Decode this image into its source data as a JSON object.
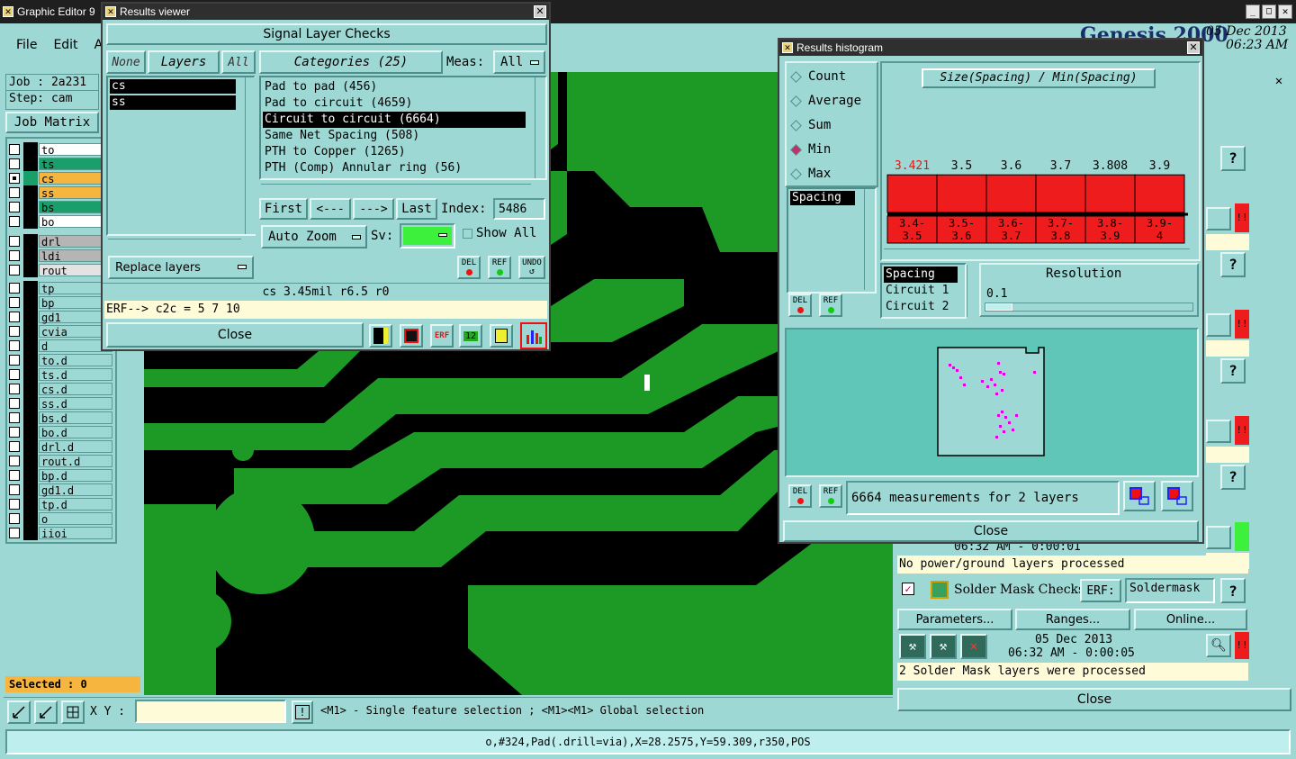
{
  "main": {
    "title": "Graphic Editor 9",
    "menu": [
      "File",
      "Edit",
      "A"
    ],
    "job_label": "Job : 2a231",
    "step_label": "Step: cam",
    "job_matrix": "Job Matrix",
    "selected": "Selected : 0",
    "xy_label": "X Y :",
    "xy_value": "",
    "hint": "<M1> - Single feature selection ; <M1><M1> Global selection",
    "status": "o,#324,Pad(.drill=via),X=28.2575,Y=59.309,r350,POS",
    "brand": "Genesis 2000",
    "date": "05 Dec 2013",
    "time": "06:23 AM"
  },
  "layers": [
    {
      "name": "to",
      "color": "#ffffff"
    },
    {
      "name": "ts",
      "color": "#1a9e6a"
    },
    {
      "name": "cs",
      "color": "#f5b53f",
      "active": true
    },
    {
      "name": "ss",
      "color": "#f5b53f"
    },
    {
      "name": "bs",
      "color": "#1a9e6a"
    },
    {
      "name": "bo",
      "color": "#ffffff"
    },
    {
      "name": "drl",
      "color": "#b5b5b5"
    },
    {
      "name": "ldi",
      "color": "#b5b5b5"
    },
    {
      "name": "rout",
      "color": "#e3e3e3"
    },
    {
      "name": "tp",
      "color": "#9ed8d4"
    },
    {
      "name": "bp",
      "color": "#9ed8d4"
    },
    {
      "name": "gd1",
      "color": "#9ed8d4"
    },
    {
      "name": "cvia",
      "color": "#9ed8d4"
    },
    {
      "name": "d",
      "color": "#9ed8d4"
    },
    {
      "name": "to.d",
      "color": "#9ed8d4",
      "mark": true
    },
    {
      "name": "ts.d",
      "color": "#9ed8d4"
    },
    {
      "name": "cs.d",
      "color": "#9ed8d4",
      "mark": true
    },
    {
      "name": "ss.d",
      "color": "#9ed8d4",
      "mark": true
    },
    {
      "name": "bs.d",
      "color": "#9ed8d4"
    },
    {
      "name": "bo.d",
      "color": "#9ed8d4",
      "mark": true
    },
    {
      "name": "drl.d",
      "color": "#9ed8d4"
    },
    {
      "name": "rout.d",
      "color": "#9ed8d4"
    },
    {
      "name": "bp.d",
      "color": "#9ed8d4"
    },
    {
      "name": "gd1.d",
      "color": "#9ed8d4"
    },
    {
      "name": "tp.d",
      "color": "#9ed8d4"
    },
    {
      "name": "o",
      "color": "#9ed8d4"
    },
    {
      "name": "iioi",
      "color": "#9ed8d4"
    }
  ],
  "viewer": {
    "title": "Results viewer",
    "heading": "Signal Layer Checks",
    "none_btn": "None",
    "layers_btn": "Layers",
    "all_btn": "All",
    "categories_btn": "Categories (25)",
    "meas_label": "Meas:",
    "meas_value": "All",
    "layer_items": [
      "cs",
      "ss"
    ],
    "categories": [
      "Pad to pad (456)",
      "Pad to circuit (4659)",
      "Circuit to circuit (6664)",
      "Same Net Spacing (508)",
      "PTH to Copper (1265)",
      "PTH (Comp) Annular ring (56)"
    ],
    "first": "First",
    "prev": "<---",
    "next": "--->",
    "last": "Last",
    "index_label": "Index:",
    "index_value": "5486",
    "auto_zoom": "Auto Zoom",
    "sv_label": "Sv:",
    "show_all": "Show All",
    "replace_layers": "Replace layers",
    "del": "DEL",
    "ref": "REF",
    "undo": "UNDO",
    "info": "cs 3.45mil  r6.5  r0",
    "erf": "ERF--> c2c = 5 7 10",
    "close": "Close"
  },
  "histogram": {
    "title": "Results histogram",
    "modes": [
      "Count",
      "Average",
      "Sum",
      "Min",
      "Max"
    ],
    "selected_mode": "Min",
    "plot_title": "Size(Spacing) / Min(Spacing)",
    "measure_list": [
      "Spacing"
    ],
    "field_list": [
      "Spacing",
      "Circuit 1",
      "Circuit 2"
    ],
    "resolution_label": "Resolution",
    "resolution_value": "0.1",
    "summary": "6664 measurements for 2 layers",
    "del": "DEL",
    "ref": "REF",
    "close": "Close",
    "bar_color": "#ee1c1c"
  },
  "chart_data": {
    "type": "bar",
    "title": "Size(Spacing) / Min(Spacing)",
    "categories": [
      "3.4-3.5",
      "3.5-3.6",
      "3.6-3.7",
      "3.7-3.8",
      "3.8-3.9",
      "3.9-4"
    ],
    "values": [
      3.421,
      3.5,
      3.6,
      3.7,
      3.808,
      3.9
    ],
    "value_labels": [
      "3.421",
      "3.5",
      "3.6",
      "3.7",
      "3.808",
      "3.9"
    ],
    "xlabel": "",
    "ylabel": ""
  },
  "checks": {
    "status1": "No power/ground layers processed",
    "time1": "06:32 AM - 0:00:01",
    "solder_title": "Solder Mask Checks",
    "erf_label": "ERF:",
    "erf_value": "Soldermask",
    "parameters": "Parameters...",
    "ranges": "Ranges...",
    "online": "Online...",
    "date": "05 Dec 2013",
    "time2": "06:32 AM - 0:00:05",
    "status2": "2 Solder Mask layers were processed",
    "close": "Close",
    "help": "?"
  }
}
